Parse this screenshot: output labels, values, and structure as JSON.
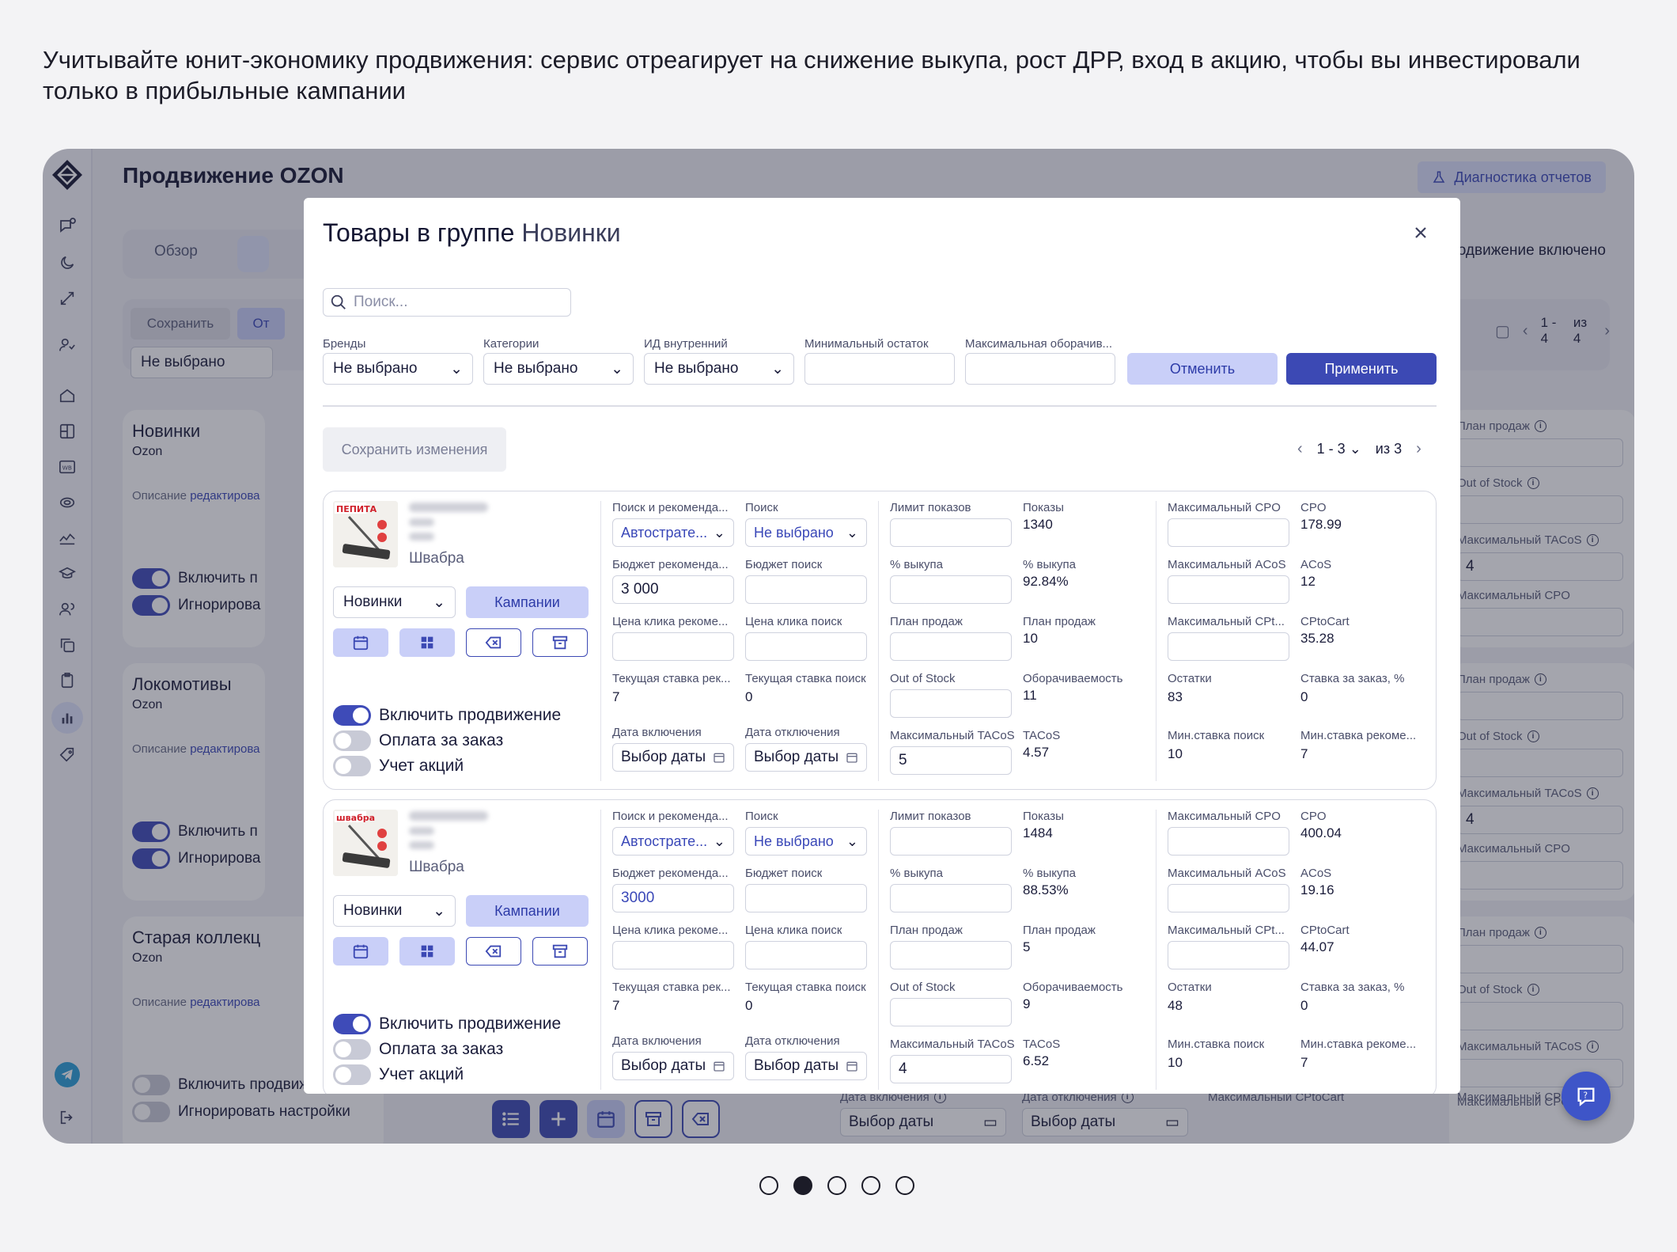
{
  "caption": "Учитывайте юнит-экономику продвижения: сервис отреагирует на снижение выкупа, рост ДРР, вход в акцию, чтобы вы инвестировали только в прибыльные кампании",
  "colors": {
    "accent": "#3c49b4",
    "accent_light": "#c9cff8",
    "overlay": "rgba(38,40,60,0.42)"
  },
  "app": {
    "title": "Продвижение OZON",
    "diag_button": "Диагностика отчетов",
    "tabs": [
      "Обзор"
    ],
    "promo_status": "Продвижение включено",
    "save": "Сохранить",
    "cancel_partial": "От",
    "filter_value": "Не выбрано",
    "pager": {
      "range": "1 - 4",
      "of": "из 4"
    },
    "groups": [
      {
        "name": "Новинки",
        "mp": "Ozon",
        "desc": "Описание",
        "edit": "редактирова",
        "tog1": "Включить п",
        "tog2": "Игнорирова"
      },
      {
        "name": "Локомотивы",
        "mp": "Ozon",
        "desc": "Описание",
        "edit": "редактирова",
        "tog1": "Включить п",
        "tog2": "Игнорирова"
      },
      {
        "name": "Старая коллекц",
        "mp": "Ozon",
        "desc": "Описание",
        "edit": "редактирова",
        "tog1": "Включить продвижение",
        "tog2": "Игнорировать настройки"
      }
    ],
    "right_col": {
      "sales_plan": "План продаж",
      "out_of_stock": "Out of Stock",
      "max_tacos": "Максимальный TACoS",
      "max_tacos_value": "4",
      "max_cpo": "Максимальный CPO",
      "max_cptocart": "Максимальный CPtoCart"
    },
    "bottom": {
      "date_on": "Дата включения",
      "date_off": "Дата отключения",
      "date_placeholder": "Выбор даты"
    }
  },
  "modal": {
    "title_prefix": "Товары в группе",
    "title_group": "Новинки",
    "search_placeholder": "Поиск...",
    "filters": {
      "brands": "Бренды",
      "categories": "Категории",
      "internal_id": "ИД внутренний",
      "min_stock": "Минимальный остаток",
      "max_turnover": "Максимальная оборачив...",
      "not_selected": "Не выбрано"
    },
    "cancel": "Отменить",
    "apply": "Применить",
    "save_changes": "Сохранить изменения",
    "pager": {
      "range": "1 - 3",
      "of": "из 3"
    },
    "labels": {
      "search_reco": "Поиск и рекоменда...",
      "search": "Поиск",
      "budget_reco": "Бюджет рекоменда...",
      "budget_search": "Бюджет поиск",
      "click_price_reco": "Цена клика рекоме...",
      "click_price_search": "Цена клика поиск",
      "cur_rate_reco": "Текущая ставка рек...",
      "cur_rate_search": "Текущая ставка поиск",
      "date_on": "Дата включения",
      "date_off": "Дата отключения",
      "impressions_limit": "Лимит показов",
      "impressions": "Показы",
      "buyout_pct": "% выкупа",
      "sales_plan": "План продаж",
      "out_of_stock": "Out of Stock",
      "turnover": "Оборачиваемость",
      "max_tacos": "Максимальный TACoS",
      "tacos": "TACoS",
      "max_cpo": "Максимальный CPO",
      "cpo": "CPO",
      "max_acos": "Максимальный ACoS",
      "acos": "ACoS",
      "max_cptocart": "Максимальный CPt...",
      "cptocart": "CPtoCart",
      "stock": "Остатки",
      "order_rate": "Ставка за заказ, %",
      "min_rate_search": "Мин.ставка поиск",
      "min_rate_reco": "Мин.ставка рекоме...",
      "group_btn": "Кампании",
      "date_placeholder": "Выбор даты",
      "toggle_promo": "Включить продвижение",
      "toggle_pay_order": "Оплата за заказ",
      "toggle_promos": "Учет акций"
    },
    "products": [
      {
        "image_text": "ПЕПИТА",
        "category": "Швабра",
        "group": "Новинки",
        "strategy": "Автострате...",
        "search_sel": "Не выбрано",
        "budget_reco": "3 000",
        "budget_reco_style": "normal",
        "cur_rate_reco": "7",
        "cur_rate_search": "0",
        "impressions": "1340",
        "buyout": "92.84%",
        "sales_plan": "10",
        "turnover": "11",
        "max_tacos": "5",
        "tacos": "4.57",
        "cpo": "178.99",
        "acos": "12",
        "cptocart": "35.28",
        "stock": "83",
        "order_rate": "0",
        "min_rate_search": "10",
        "min_rate_reco": "7",
        "toggles": [
          true,
          false,
          false
        ]
      },
      {
        "image_text": "швабра",
        "category": "Швабра",
        "group": "Новинки",
        "strategy": "Автострате...",
        "search_sel": "Не выбрано",
        "budget_reco": "3000",
        "budget_reco_style": "blue",
        "cur_rate_reco": "7",
        "cur_rate_search": "0",
        "impressions": "1484",
        "buyout": "88.53%",
        "sales_plan": "5",
        "turnover": "9",
        "max_tacos": "4",
        "tacos": "6.52",
        "cpo": "400.04",
        "acos": "19.16",
        "cptocart": "44.07",
        "stock": "48",
        "order_rate": "0",
        "min_rate_search": "10",
        "min_rate_reco": "7",
        "toggles": [
          true,
          false,
          false
        ]
      }
    ]
  },
  "carousel": {
    "count": 5,
    "active": 1
  }
}
